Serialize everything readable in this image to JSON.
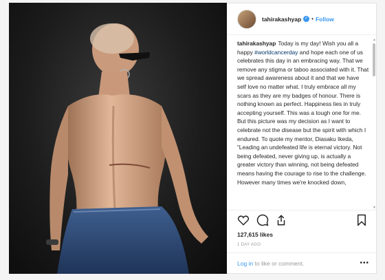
{
  "post": {
    "username": "tahirakashyap",
    "follow_label": "Follow",
    "caption_username": "tahirakashyap",
    "caption_lead": "Today is my day! Wish you all a happy ",
    "hashtag": "#worldcancerday",
    "caption_rest": " and hope each one of us celebrates this day in an embracing way. That we remove any stigma or taboo associated with it. That we spread awareness about it and that we have self love no matter what. I truly embrace all my scars as they are my badges of honour. There is nothing known as perfect. Happiness lies in truly accepting yourself. This was a tough one for me. But this picture was my decision as I want to celebrate not the disease but the spirit with which I endured. To quote my mentor, Diasaku Ikeda, “Leading an undefeated life is eternal victory. Not being defeated, never giving up, is actually a greater victory than winning, not being defeated means having the courage to rise to the challenge. However many times we're knocked down,",
    "likes": "127,615 likes",
    "time_ago": "1 DAY AGO",
    "login_link": "Log in",
    "login_rest": " to like or comment.",
    "more_dots": "•••"
  },
  "icons": [
    "verified-badge-icon",
    "heart-icon",
    "comment-icon",
    "share-icon",
    "bookmark-icon",
    "more-options-icon"
  ],
  "colors": {
    "accent": "#3897f0",
    "text": "#262626",
    "muted": "#999999",
    "background": "#f4f4f4"
  }
}
